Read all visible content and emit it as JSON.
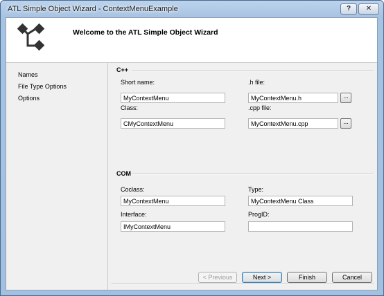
{
  "window": {
    "title": "ATL Simple Object Wizard - ContextMenuExample",
    "help_label": "?",
    "close_label": "✕"
  },
  "header": {
    "logo_icon": "wizard-logo-icon",
    "heading": "Welcome to the ATL Simple Object Wizard"
  },
  "nav": {
    "items": [
      {
        "label": "Names"
      },
      {
        "label": "File Type Options"
      },
      {
        "label": "Options"
      }
    ]
  },
  "cpp": {
    "section_title": "C++",
    "short_name_label": "Short name:",
    "short_name_value": "MyContextMenu",
    "h_file_label": ".h file:",
    "h_file_value": "MyContextMenu.h",
    "class_label": "Class:",
    "class_value": "CMyContextMenu",
    "cpp_file_label": ".cpp file:",
    "cpp_file_value": "MyContextMenu.cpp",
    "browse_label": "..."
  },
  "com": {
    "section_title": "COM",
    "coclass_label": "Coclass:",
    "coclass_value": "MyContextMenu",
    "type_label": "Type:",
    "type_value": "MyContextMenu Class",
    "interface_label": "Interface:",
    "interface_value": "IMyContextMenu",
    "progid_label": "ProgID:",
    "progid_value": ""
  },
  "buttons": {
    "previous": "< Previous",
    "next": "Next >",
    "finish": "Finish",
    "cancel": "Cancel"
  }
}
